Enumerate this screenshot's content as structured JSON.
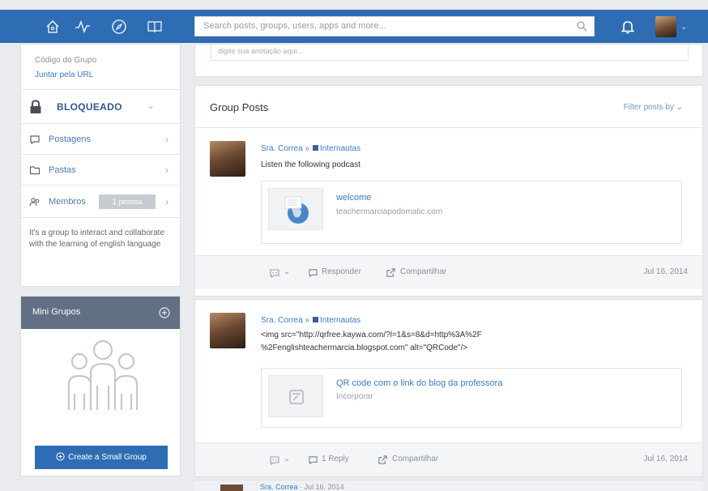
{
  "header": {
    "search_placeholder": "Search posts, groups, users, apps and more...",
    "nav_icons": [
      "home-icon",
      "activity-icon",
      "compass-icon",
      "book-icon"
    ],
    "accent": "#2e6db3"
  },
  "sidebar": {
    "group_code_label": "Código do Grupo",
    "join_url_link": "Juntar pela URL",
    "locked_label": "BLOQUEADO",
    "posts_label": "Postagens",
    "folders_label": "Pastas",
    "members_label": "Membros",
    "members_count": "1 pessoa",
    "description": "It's a group to interact and collaborate with the learning of english language",
    "mini_groups_title": "Mini Grupos",
    "create_small_group": "Create a Small Group"
  },
  "annotation": {
    "placeholder": "digite sua anotação aqui..."
  },
  "group_posts": {
    "title": "Group Posts",
    "filter_label": "Filter posts by"
  },
  "posts": [
    {
      "author": "Sra. Correa",
      "separator": "»",
      "group": "Internautas",
      "text": "Listen the following podcast",
      "attach_title": "welcome",
      "attach_sub": "teachermarciapodomatic.com",
      "actions": {
        "reply": "Responder",
        "share": "Compartilhar"
      },
      "date": "Jul 16, 2014"
    },
    {
      "author": "Sra. Correa",
      "separator": "»",
      "group": "Internautas",
      "text_line1": "<img src=\"http://qrfree.kaywa.com/?l=1&s=8&d=http%3A%2F",
      "text_line2": "%2Fenglishteachermarcia.blogspot.com\" alt=\"QRCode\"/>",
      "attach_title": "QR code com o link do blog da professora",
      "attach_sub": "Incorporar",
      "actions": {
        "reply": "1 Reply",
        "share": "Compartilhar"
      },
      "date": "Jul 16, 2014"
    }
  ],
  "partial_post": {
    "author": "Sra. Correa",
    "date": "Jul 16, 2014"
  }
}
